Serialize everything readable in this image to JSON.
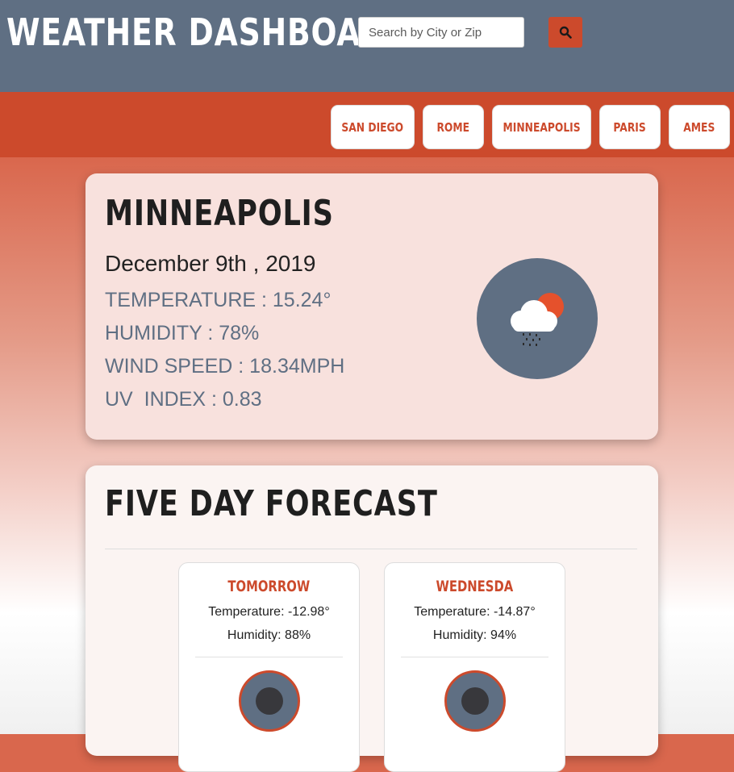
{
  "header": {
    "title": "WEATHER DASHBOARD",
    "search_placeholder": "Search by City or Zip",
    "search_icon": "search-icon"
  },
  "cities": [
    {
      "label": "SAN DIEGO"
    },
    {
      "label": "ROME"
    },
    {
      "label": "MINNEAPOLIS"
    },
    {
      "label": "PARIS"
    },
    {
      "label": "AMES"
    }
  ],
  "current": {
    "city": "MINNEAPOLIS",
    "date": "December 9th , 2019",
    "temperature": "TEMPERATURE : 15.24°",
    "humidity": "HUMIDITY : 78%",
    "wind_speed": "WIND SPEED : 18.34MPH",
    "uv_index": "UV  INDEX : 0.83",
    "icon": "snow-rain-sun-icon"
  },
  "forecast": {
    "heading": "FIVE DAY FORECAST",
    "days": [
      {
        "name": "TOMORROW",
        "temperature": "Temperature: -12.98°",
        "humidity": "Humidity: 88%"
      },
      {
        "name": "WEDNESDA",
        "temperature": "Temperature: -14.87°",
        "humidity": "Humidity: 94%"
      }
    ]
  },
  "colors": {
    "header_bg": "#5f6f83",
    "accent": "#cc4a2c",
    "text_muted": "#5f6f83"
  }
}
